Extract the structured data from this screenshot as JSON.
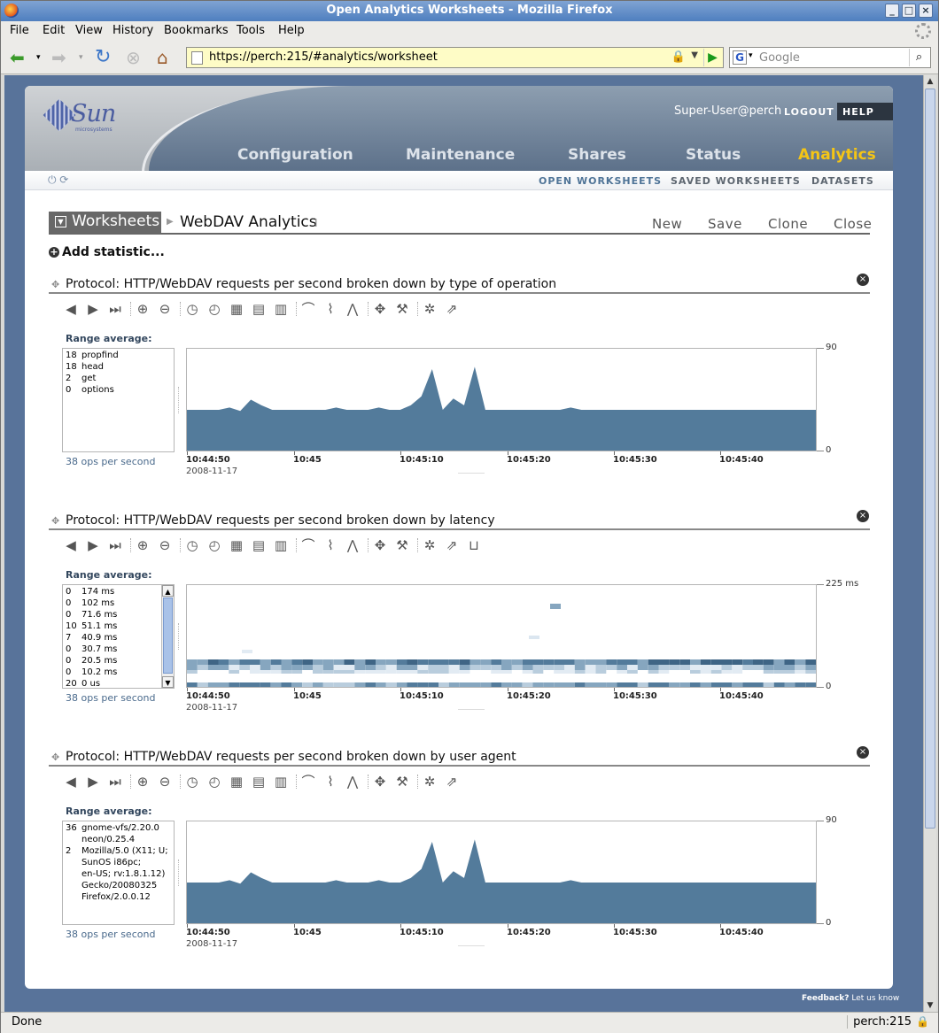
{
  "window": {
    "title": "Open Analytics Worksheets - Mozilla Firefox"
  },
  "menu": [
    "File",
    "Edit",
    "View",
    "History",
    "Bookmarks",
    "Tools",
    "Help"
  ],
  "navigation": {
    "url": "https://perch:215/#analytics/worksheet",
    "search_placeholder": "Google"
  },
  "header": {
    "logo": "Sun",
    "logo_sub": "microsystems",
    "user": "Super-User@perch",
    "logout": "LOGOUT",
    "help": "HELP",
    "tabs": [
      "Configuration",
      "Maintenance",
      "Shares",
      "Status",
      "Analytics"
    ],
    "active_tab": "Analytics",
    "subnav": [
      "OPEN WORKSHEETS",
      "SAVED WORKSHEETS",
      "DATASETS"
    ]
  },
  "worksheet": {
    "button": "Worksheets",
    "title": "WebDAV Analytics",
    "actions": [
      "New",
      "Save",
      "Clone",
      "Close"
    ],
    "add_statistic": "Add statistic..."
  },
  "common": {
    "range_label": "Range average:",
    "x_ticks": [
      "10:44:50",
      "10:45",
      "10:45:10",
      "10:45:20",
      "10:45:30",
      "10:45:40"
    ],
    "date": "2008-11-17"
  },
  "statistics": [
    {
      "title": "Protocol: HTTP/WebDAV requests per second broken down by type of operation",
      "legend": [
        {
          "v": "18",
          "n": "propfind"
        },
        {
          "v": "18",
          "n": "head"
        },
        {
          "v": "2",
          "n": "get"
        },
        {
          "v": "0",
          "n": "options"
        }
      ],
      "summary": "38 ops per second",
      "y_max_label": "90",
      "y_min_label": "0"
    },
    {
      "title": "Protocol: HTTP/WebDAV requests per second broken down by latency",
      "legend": [
        {
          "v": "0",
          "n": "174 ms"
        },
        {
          "v": "0",
          "n": "102 ms"
        },
        {
          "v": "0",
          "n": "71.6 ms"
        },
        {
          "v": "10",
          "n": "51.1 ms"
        },
        {
          "v": "7",
          "n": "40.9 ms"
        },
        {
          "v": "0",
          "n": "30.7 ms"
        },
        {
          "v": "0",
          "n": "20.5 ms"
        },
        {
          "v": "0",
          "n": "10.2 ms"
        },
        {
          "v": "20",
          "n": "0 us"
        }
      ],
      "summary": "38 ops per second",
      "y_max_label": "225 ms",
      "y_min_label": "0"
    },
    {
      "title": "Protocol: HTTP/WebDAV requests per second broken down by user agent",
      "legend": [
        {
          "v": "36",
          "n": "gnome-vfs/2.20.0"
        },
        {
          "v": "",
          "n": "neon/0.25.4"
        },
        {
          "v": "2",
          "n": "Mozilla/5.0 (X11; U;"
        },
        {
          "v": "",
          "n": "SunOS i86pc;"
        },
        {
          "v": "",
          "n": "en-US; rv:1.8.1.12)"
        },
        {
          "v": "",
          "n": "Gecko/20080325"
        },
        {
          "v": "",
          "n": "Firefox/2.0.0.12"
        }
      ],
      "summary": "38 ops per second",
      "y_max_label": "90",
      "y_min_label": "0"
    }
  ],
  "chart_data": [
    {
      "type": "area",
      "x_start": "10:44:50",
      "x_end": "10:45:49",
      "ylim": [
        0,
        90
      ],
      "values": [
        36,
        36,
        36,
        36,
        38,
        35,
        45,
        40,
        36,
        36,
        36,
        36,
        36,
        36,
        38,
        36,
        36,
        36,
        38,
        36,
        36,
        40,
        36,
        36,
        36,
        36,
        38,
        36,
        36,
        36,
        36,
        36,
        36,
        36,
        36,
        36,
        38,
        36,
        36,
        36,
        36,
        36,
        36,
        36,
        36,
        36,
        36,
        36,
        36,
        36,
        36,
        36,
        36,
        36,
        36,
        36,
        36,
        36,
        36,
        36
      ],
      "spikes": {
        "22": 48,
        "23": 72,
        "24": 36,
        "25": 46,
        "26": 40,
        "27": 74,
        "28": 36
      }
    },
    {
      "type": "heatmap",
      "x_start": "10:44:50",
      "x_end": "10:45:49",
      "ylim": [
        0,
        225
      ],
      "unit": "ms",
      "bands": [
        "0 us",
        "10.2 ms",
        "20.5 ms",
        "30.7 ms",
        "40.9 ms",
        "51.1 ms",
        "71.6 ms",
        "102 ms",
        "174 ms"
      ]
    },
    {
      "type": "area",
      "x_start": "10:44:50",
      "x_end": "10:45:49",
      "ylim": [
        0,
        90
      ]
    }
  ],
  "footer": {
    "feedback": "Feedback?",
    "feedback_link": "Let us know"
  },
  "status": {
    "text": "Done",
    "host": "perch:215"
  }
}
